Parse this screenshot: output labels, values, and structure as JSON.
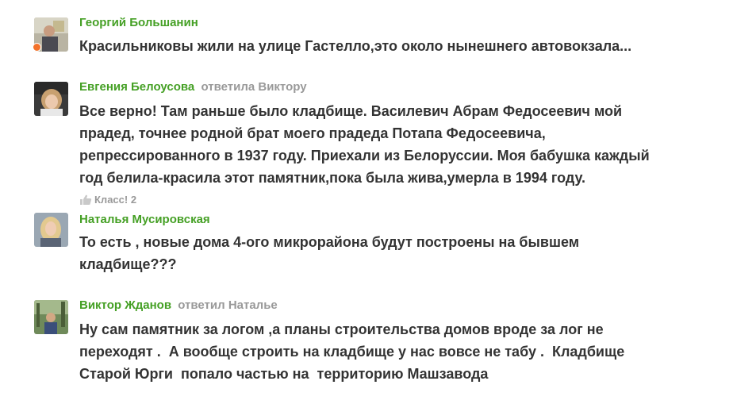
{
  "comments": [
    {
      "author": "Георгий Большанин",
      "reply_to": "",
      "online": true,
      "text": "Красильниковы жили на улице Гастелло,это около нынешнего автовокзала...",
      "likes": ""
    },
    {
      "author": "Евгения Белоусова",
      "reply_to": "ответила Виктору",
      "online": false,
      "text": "Все верно! Там раньше было кладбище. Василевич Абрам Федосеевич мой\nпрадед, точнее родной брат моего прадеда Потапа Федосеевича,\nрепрессированного в 1937 году. Приехали из Белоруссии. Моя бабушка каждый\nгод белила-красила этот памятник,пока была жива,умерла в 1994 году.",
      "likes": "Класс! 2"
    },
    {
      "author": "Наталья Мусировская",
      "reply_to": "",
      "online": false,
      "text": "То есть , новые дома 4-ого микрорайона будут построены на бывшем\nкладбище???",
      "likes": ""
    },
    {
      "author": "Виктор Жданов",
      "reply_to": "ответил Наталье",
      "online": false,
      "text": "Ну сам памятник за логом ,а планы строительства домов вроде за лог не\nпереходят .  А вообще строить на кладбище у нас вовсе не табу .  Кладбище\nСтарой Юрги  попало частью на  территорию Машзавода",
      "likes": ""
    }
  ],
  "icons": {
    "like": "thumb-up-icon",
    "online": "online-status-dot"
  },
  "colors": {
    "author": "#45a025",
    "reply_to": "#999999",
    "text": "#333333",
    "online": "#f3722b"
  }
}
